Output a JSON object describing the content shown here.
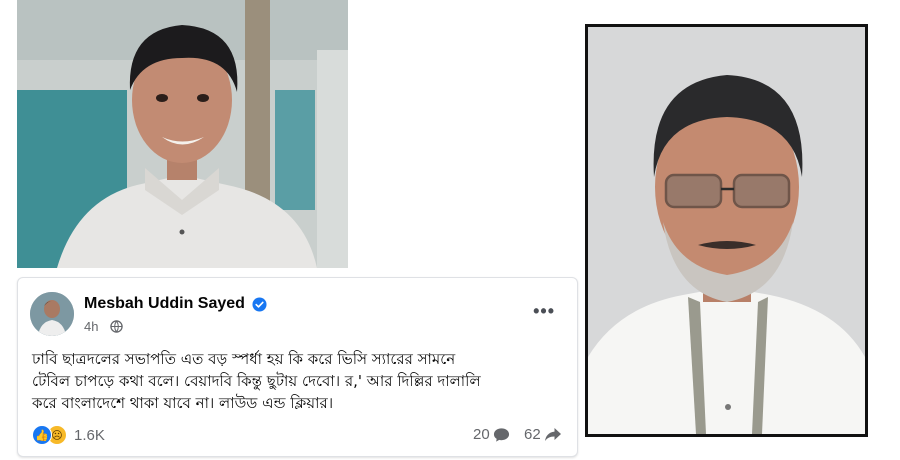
{
  "post": {
    "author": "Mesbah Uddin Sayed",
    "time": "4h",
    "text_line1": "ঢাবি ছাত্রদলের সভাপতি এত বড় স্পর্ধা হয় কি করে ভিসি স্যারের সামনে",
    "text_line2": "টেবিল চাপড়ে কথা বলে। বেয়াদবি কিন্তু ছুটায় দেবো। র,' আর দিল্লির দালালি",
    "text_line3": "করে বাংলাদেশে থাকা  যাবে না। লাউড এন্ড ক্লিয়ার।",
    "reactions_count": "1.6K",
    "comments_count": "20",
    "shares_count": "62"
  },
  "icons": {
    "verified": "verified-badge-icon",
    "globe": "globe-icon",
    "more": "more-options-icon",
    "like": "like-reaction-icon",
    "sad": "sad-reaction-icon",
    "comment": "comment-icon",
    "share": "share-icon"
  },
  "colors": {
    "facebook_blue": "#1877f2",
    "text_primary": "#050505",
    "text_secondary": "#65676b"
  }
}
